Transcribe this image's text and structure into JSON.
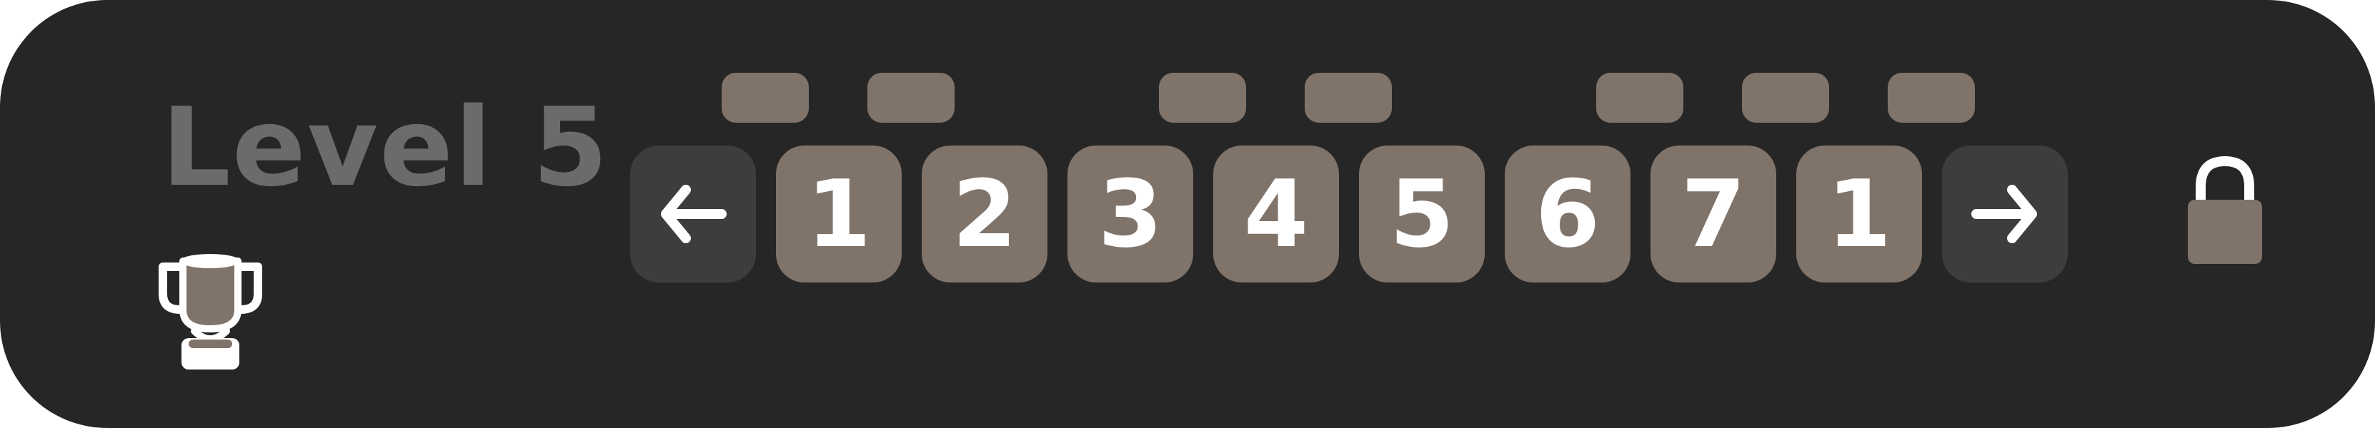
{
  "level": {
    "label": "Level 5"
  },
  "sequence": {
    "tiles": [
      "1",
      "2",
      "3",
      "4",
      "5",
      "6",
      "7",
      "1"
    ]
  },
  "controls": {
    "prev_icon": "arrow-left-icon",
    "next_icon": "arrow-right-icon"
  },
  "icons": {
    "trophy": "trophy-icon",
    "lock": "lock-icon"
  },
  "colors": {
    "background": "#262626",
    "tile": "#80736a",
    "arrow_button": "#3d3d3d",
    "level_text": "#6b6b6b",
    "glyph": "#ffffff"
  }
}
